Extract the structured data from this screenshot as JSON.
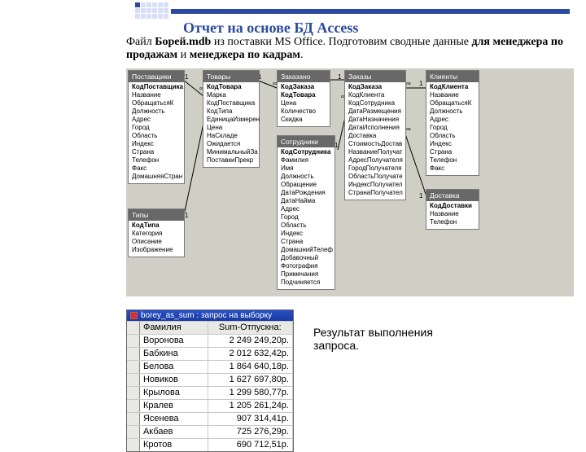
{
  "title": "Отчет на основе БД Access",
  "subtitle": {
    "t1": "Файл ",
    "b1": "Борей.mdb",
    "t2": " из поставки MS Office. Подготовим сводные данные ",
    "b2": "для менеджера по продажам",
    "t3": " и ",
    "b3": "менеджера по кадрам",
    "t4": "."
  },
  "result_caption": "Результат выполнения запроса.",
  "tables": {
    "suppliers": {
      "title": "Поставщики",
      "fields": [
        "КодПоставщика",
        "Название",
        "ОбращатьсяК",
        "Должность",
        "Адрес",
        "Город",
        "Область",
        "Индекс",
        "Страна",
        "Телефон",
        "Факс",
        "ДомашняяСтран"
      ]
    },
    "types": {
      "title": "Типы",
      "fields": [
        "КодТипа",
        "Категория",
        "Описание",
        "Изображение"
      ]
    },
    "goods": {
      "title": "Товары",
      "fields": [
        "КодТовара",
        "Марка",
        "КодПоставщика",
        "КодТипа",
        "ЕдиницаИзмерен",
        "Цена",
        "НаСкладе",
        "Ожидается",
        "МинимальныйЗа",
        "ПоставкиПрекр"
      ]
    },
    "ordered": {
      "title": "Заказано",
      "fields": [
        "КодЗаказа",
        "КодТовара",
        "Цена",
        "Количество",
        "Скидка"
      ]
    },
    "employees": {
      "title": "Сотрудники",
      "fields": [
        "КодСотрудника",
        "Фамилия",
        "Имя",
        "Должность",
        "Обращение",
        "ДатаРождения",
        "ДатаНайма",
        "Адрес",
        "Город",
        "Область",
        "Индекс",
        "Страна",
        "ДомашнийТелеф",
        "Добавочный",
        "Фотография",
        "Примечания",
        "Подчиняется"
      ]
    },
    "orders": {
      "title": "Заказы",
      "fields": [
        "КодЗаказа",
        "КодКлиента",
        "КодСотрудника",
        "ДатаРазмещения",
        "ДатаНазначения",
        "ДатаИсполнения",
        "Доставка",
        "СтоимостьДостав",
        "НазваниеПолучат",
        "АдресПолучателя",
        "ГородПолучателя",
        "ОбластьПолучате",
        "ИндексПолучател",
        "СтранаПолучател"
      ]
    },
    "clients": {
      "title": "Клиенты",
      "fields": [
        "КодКлиента",
        "Название",
        "ОбращатьсяК",
        "Должность",
        "Адрес",
        "Город",
        "Область",
        "Индекс",
        "Страна",
        "Телефон",
        "Факс"
      ]
    },
    "delivery": {
      "title": "Доставка",
      "fields": [
        "КодДоставки",
        "Название",
        "Телефон"
      ]
    }
  },
  "rel": {
    "one": "1",
    "inf": "∞"
  },
  "query": {
    "title": "borey_as_sum : запрос на выборку",
    "col1": "Фамилия",
    "col2": "Sum-Отпускна:",
    "rows": [
      {
        "n": "Воронова",
        "v": "2 249 249,20р."
      },
      {
        "n": "Бабкина",
        "v": "2 012 632,42р."
      },
      {
        "n": "Белова",
        "v": "1 864 640,18р."
      },
      {
        "n": "Новиков",
        "v": "1 627 697,80р."
      },
      {
        "n": "Крылова",
        "v": "1 299 580,77р."
      },
      {
        "n": "Кралев",
        "v": "1 205 261,24р."
      },
      {
        "n": "Ясенева",
        "v": "907 314,41р."
      },
      {
        "n": "Акбаев",
        "v": "725 276,29р."
      },
      {
        "n": "Кротов",
        "v": "690 712,51р."
      }
    ]
  }
}
